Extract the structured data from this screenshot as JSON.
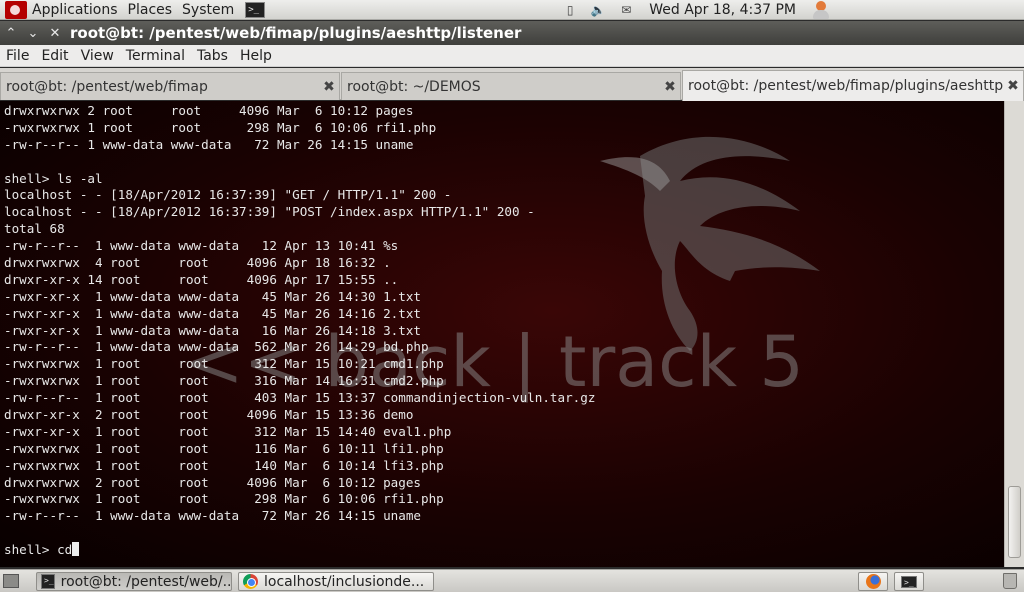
{
  "top_panel": {
    "menus": [
      "Applications",
      "Places",
      "System"
    ],
    "clock": "Wed Apr 18,  4:37 PM"
  },
  "window": {
    "title": "root@bt: /pentest/web/fimap/plugins/aeshttp/listener"
  },
  "menubar": [
    "File",
    "Edit",
    "View",
    "Terminal",
    "Tabs",
    "Help"
  ],
  "tabs": [
    {
      "label": "root@bt: /pentest/web/fimap"
    },
    {
      "label": "root@bt: ~/DEMOS"
    },
    {
      "label": "root@bt: /pentest/web/fimap/plugins/aeshttp/..."
    }
  ],
  "terminal": {
    "lines": [
      "drwxrwxrwx 2 root     root     4096 Mar  6 10:12 pages",
      "-rwxrwxrwx 1 root     root      298 Mar  6 10:06 rfi1.php",
      "-rw-r--r-- 1 www-data www-data   72 Mar 26 14:15 uname",
      "",
      "shell> ls -al",
      "localhost - - [18/Apr/2012 16:37:39] \"GET / HTTP/1.1\" 200 -",
      "localhost - - [18/Apr/2012 16:37:39] \"POST /index.aspx HTTP/1.1\" 200 -",
      "total 68",
      "-rw-r--r--  1 www-data www-data   12 Apr 13 10:41 %s",
      "drwxrwxrwx  4 root     root     4096 Apr 18 16:32 .",
      "drwxr-xr-x 14 root     root     4096 Apr 17 15:55 ..",
      "-rwxr-xr-x  1 www-data www-data   45 Mar 26 14:30 1.txt",
      "-rwxr-xr-x  1 www-data www-data   45 Mar 26 14:16 2.txt",
      "-rwxr-xr-x  1 www-data www-data   16 Mar 26 14:18 3.txt",
      "-rw-r--r--  1 www-data www-data  562 Mar 26 14:29 bd.php",
      "-rwxrwxrwx  1 root     root      312 Mar 15 10:21 cmd1.php",
      "-rwxrwxrwx  1 root     root      316 Mar 14 16:31 cmd2.php",
      "-rw-r--r--  1 root     root      403 Mar 15 13:37 commandinjection-vuln.tar.gz",
      "drwxr-xr-x  2 root     root     4096 Mar 15 13:36 demo",
      "-rwxr-xr-x  1 root     root      312 Mar 15 14:40 eval1.php",
      "-rwxrwxrwx  1 root     root      116 Mar  6 10:11 lfi1.php",
      "-rwxrwxrwx  1 root     root      140 Mar  6 10:14 lfi3.php",
      "drwxrwxrwx  2 root     root     4096 Mar  6 10:12 pages",
      "-rwxrwxrwx  1 root     root      298 Mar  6 10:06 rfi1.php",
      "-rw-r--r--  1 www-data www-data   72 Mar 26 14:15 uname",
      ""
    ],
    "prompt": "shell> cd",
    "logo_text": "<< back | track 5"
  },
  "taskbar": [
    {
      "label": "root@bt: /pentest/web/..."
    },
    {
      "label": "localhost/inclusionde..."
    }
  ],
  "colors": {
    "terminal_bg": "#1a0202",
    "terminal_fg": "#e8e8e8",
    "panel_bg": "#e4e3df",
    "titlebar_bg": "#4a4a47"
  }
}
